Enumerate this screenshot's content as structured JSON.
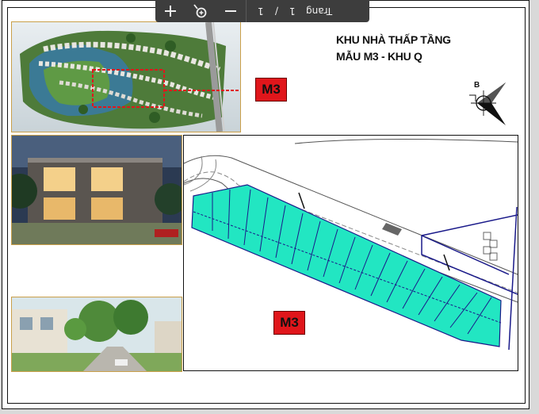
{
  "toolbar": {
    "zoom_in_icon": "plus-icon",
    "zoom_reset_icon": "zoom-icon",
    "zoom_out_icon": "minus-icon",
    "current_page": "1",
    "separator": "/",
    "total_pages": "1",
    "page_label": "Trang"
  },
  "document": {
    "title_line1": "KHU NHÀ THẤP TẦNG",
    "title_line2": "MẪU M3 - KHU Q",
    "badge_top": "M3",
    "badge_plan": "M3",
    "compass_letter": "B",
    "compass_icon": "north-arrow-icon"
  },
  "colors": {
    "lot_fill": "#22e6c2",
    "badge": "#e0161b",
    "toolbar": "#3d3d3d"
  }
}
